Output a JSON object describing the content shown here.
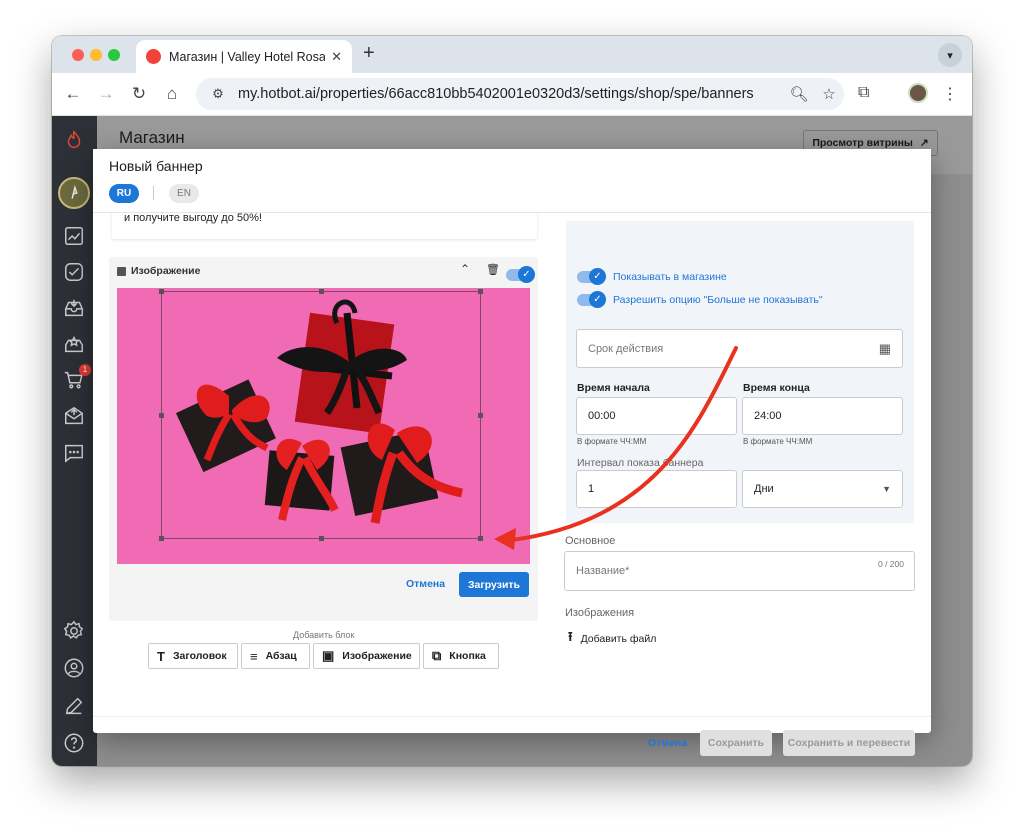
{
  "browser": {
    "tab_title": "Магазин | Valley Hotel Rosa K",
    "tab_close": "✕",
    "new_tab": "+",
    "url": "my.hotbot.ai/properties/66acc810bb5402001e0320d3/settings/shop/spe/banners"
  },
  "app": {
    "page_title": "Магазин",
    "storefront_button": "Просмотр витрины",
    "cart_badge": "1"
  },
  "modal": {
    "title": "Новый баннер",
    "lang_ru": "RU",
    "lang_en": "EN",
    "text_block": "и получите выгоду до 50%!",
    "image_block": {
      "header": "Изображение",
      "cancel": "Отмена",
      "upload": "Загрузить"
    },
    "add_block": {
      "label": "Добавить блок",
      "heading": "Заголовок",
      "paragraph": "Абзац",
      "image": "Изображение",
      "button": "Кнопка"
    },
    "settings": {
      "show_in_shop": "Показывать в магазине",
      "allow_dont_show": "Разрешить опцию \"Больше не показывать\"",
      "validity_placeholder": "Срок действия",
      "start_label": "Время начала",
      "start_value": "00:00",
      "start_hint": "В формате ЧЧ:ММ",
      "end_label": "Время конца",
      "end_value": "24:00",
      "end_hint": "В формате ЧЧ:ММ",
      "interval_label": "Интервал показа баннера",
      "interval_value": "1",
      "interval_unit": "Дни"
    },
    "main": {
      "section": "Основное",
      "name_placeholder": "Название*",
      "counter": "0 / 200",
      "images_section": "Изображения",
      "add_file": "Добавить файл"
    },
    "footer": {
      "cancel": "Отмена",
      "save": "Сохранить",
      "save_translate": "Сохранить и перевести"
    }
  },
  "colors": {
    "accent": "#1e76d6",
    "annotation_arrow": "#e8321f",
    "photo_background": "#f06bb4"
  }
}
